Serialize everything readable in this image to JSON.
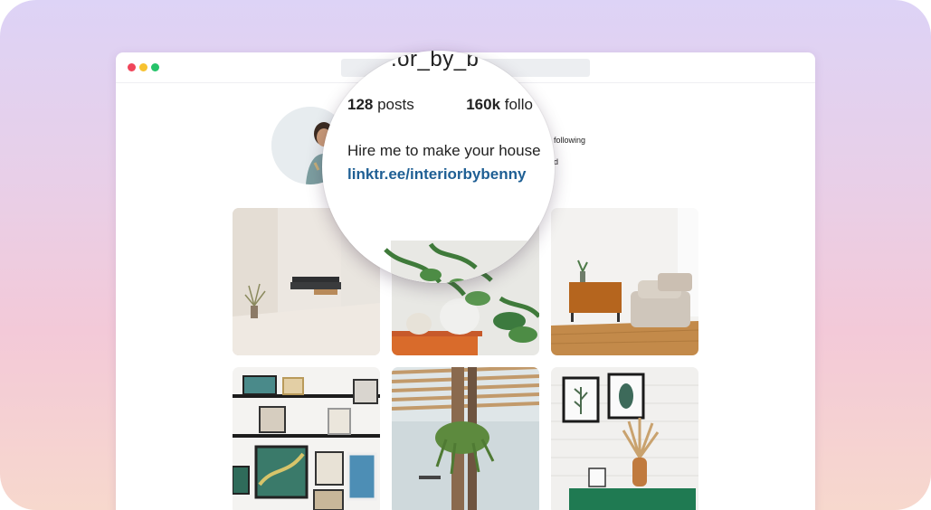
{
  "profile": {
    "username_partial": ".or_by_b",
    "posts_count": "128",
    "posts_label": " posts",
    "followers_count": "160k",
    "followers_label": " follo",
    "following_label": "following",
    "following_frag": "d",
    "bio": "Hire me to make your house",
    "link": "linktr.ee/interiorbybenny"
  },
  "window": {
    "dots": [
      "#f0455a",
      "#f7c230",
      "#26c36a"
    ]
  },
  "grid": {
    "tiles": [
      {
        "name": "tile-minimal-living-room"
      },
      {
        "name": "tile-plants-shelf"
      },
      {
        "name": "tile-armchair-sideboard"
      },
      {
        "name": "tile-gallery-wall"
      },
      {
        "name": "tile-pergola-plant"
      },
      {
        "name": "tile-brick-wall-frames"
      }
    ]
  }
}
